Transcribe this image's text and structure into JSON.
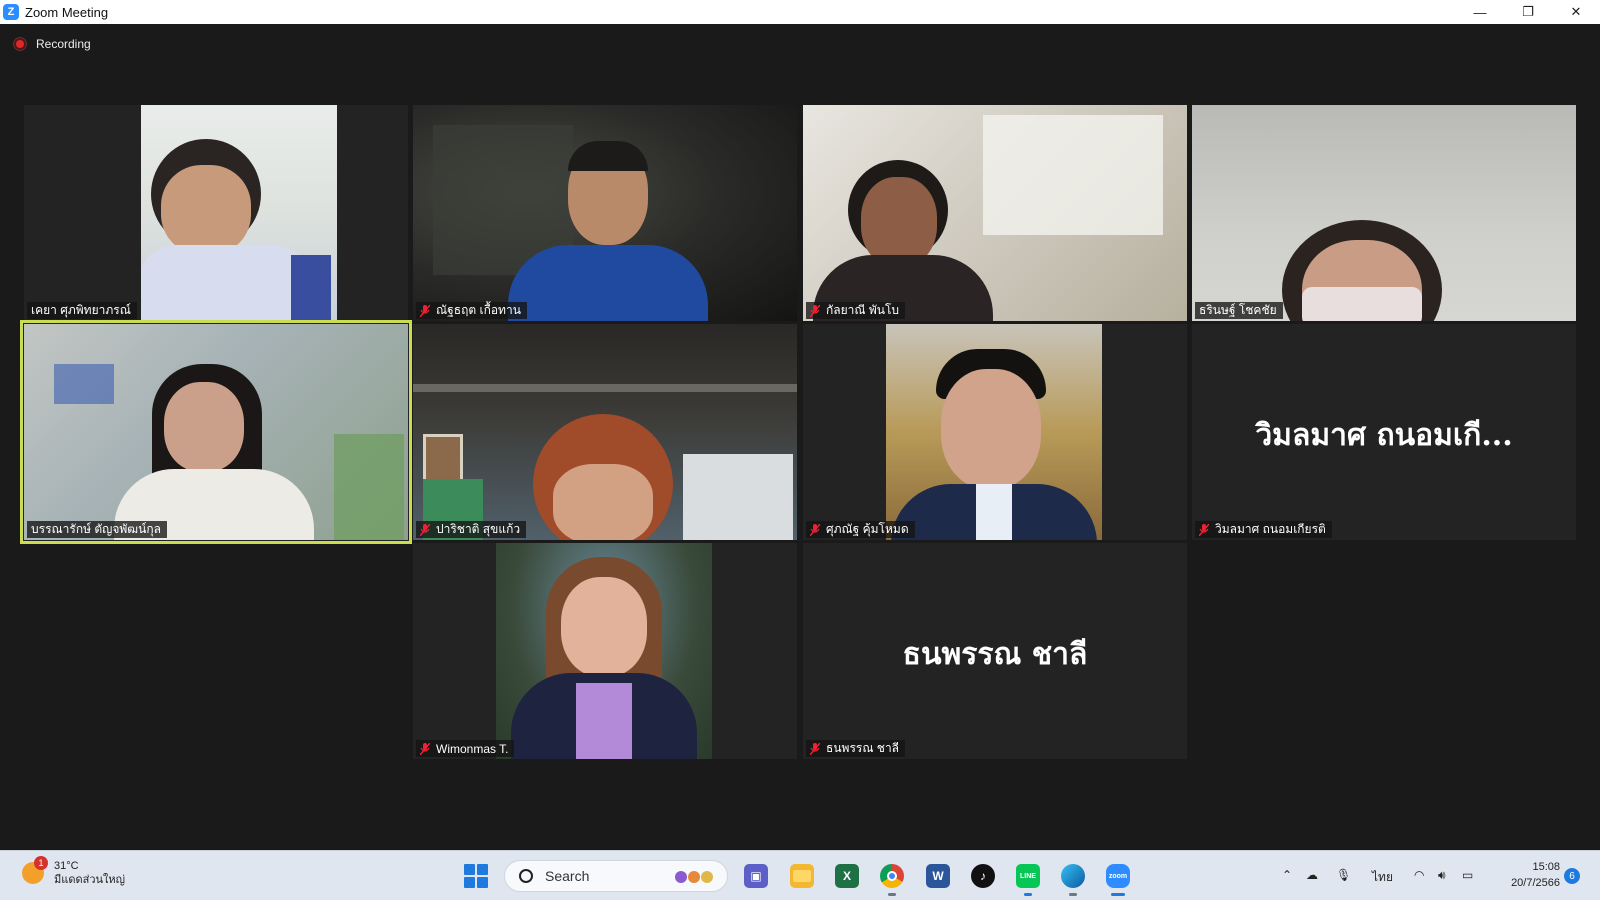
{
  "window": {
    "title": "Zoom Meeting",
    "controls": {
      "minimize": "—",
      "restore": "❐",
      "close": "✕"
    }
  },
  "meeting": {
    "recording_label": "Recording",
    "participants": [
      {
        "name": "เคยา ศุภพิทยาภรณ์",
        "muted": false,
        "video": true,
        "active": false
      },
      {
        "name": "ณัฐธฤต เกื้อทาน",
        "muted": true,
        "video": true,
        "active": false
      },
      {
        "name": "กัลยาณี พันโบ",
        "muted": true,
        "video": true,
        "active": false
      },
      {
        "name": "ธรินษฐ์ โชคชัย",
        "muted": false,
        "video": true,
        "active": false
      },
      {
        "name": "บรรณารักษ์ ตัญจพัฒน์กุล",
        "muted": false,
        "video": true,
        "active": true
      },
      {
        "name": "ปาริชาติ สุขแก้ว",
        "muted": true,
        "video": true,
        "active": false
      },
      {
        "name": "ศุภณัฐ คุ้มโหมด",
        "muted": true,
        "video": true,
        "active": false
      },
      {
        "name": "วิมลมาศ ถนอมเกียรติ",
        "muted": true,
        "video": false,
        "active": false,
        "display_name": "วิมลมาศ ถนอมเกี..."
      },
      {
        "name": "Wimonmas T.",
        "muted": true,
        "video": true,
        "active": false
      },
      {
        "name": "ธนพรรณ ชาลี",
        "muted": true,
        "video": false,
        "active": false,
        "display_name": "ธนพรรณ ชาลี"
      }
    ]
  },
  "taskbar": {
    "weather": {
      "temp": "31°C",
      "condition": "มีแดดส่วนใหญ่",
      "badge": "1"
    },
    "search_label": "Search",
    "apps": [
      "teams-icon",
      "file-explorer-icon",
      "excel-icon",
      "chrome-icon",
      "word-icon",
      "tiktok-icon",
      "line-icon",
      "edge-icon",
      "zoom-icon"
    ],
    "app_labels": {
      "word": "W",
      "excel": "X",
      "line": "LINE",
      "zoom": "zoom",
      "tiktok": "♪"
    },
    "tray": {
      "language": "ไทย"
    },
    "clock": {
      "time": "15:08",
      "date": "20/7/2566"
    },
    "notifications": "6",
    "colors": {
      "accent": "#1f7ae0",
      "active_speaker": "#c9dc52",
      "recording": "#e02828"
    }
  }
}
